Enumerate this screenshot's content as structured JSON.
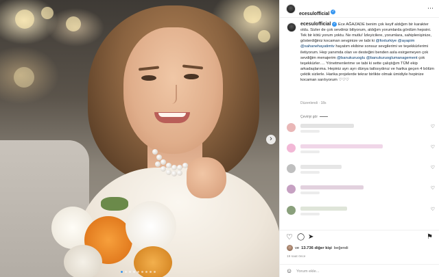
{
  "post": {
    "username": "ecesulofficial",
    "more_icon": "⋯",
    "next_icon": "›",
    "carousel_dots": 9,
    "carousel_active_index": 0,
    "caption": {
      "username": "ecesulofficial",
      "segments": [
        {
          "text": " Ece AĞAZADE benim çok keyif aldığım bir karakter oldu. Sizler de çok sevdiniz biliyorum, aldığım yorumlarda gördüm hepsini. Tek bir kötü yorum yoktu. Ne mutlu! İzleyicilere, yorumlara, sahiplenişinize, gösterdiğiniz kocaman sevginize ve tabi ki ",
          "mention": false
        },
        {
          "text": "@foxturkiye",
          "mention": true
        },
        {
          "text": " ",
          "mention": false
        },
        {
          "text": "@ayapim",
          "mention": true
        },
        {
          "text": " ",
          "mention": false
        },
        {
          "text": "@sahanehayatimtv",
          "mention": true
        },
        {
          "text": " hayatım ekibine sonsuz sevgilerimi ve teşekkürlerimi iletiyorum. Hep yanımda olan ve desteğini benden asla esirgemeyen çok sevdiğim menajerim ",
          "mention": false
        },
        {
          "text": "@banukuruoglu",
          "mention": true
        },
        {
          "text": " ",
          "mention": false
        },
        {
          "text": "@banukuruoglumanagement",
          "mention": true
        },
        {
          "text": " çok teşekkürler…. Yönetmenlerime ve tabi ki sette çalıştığım TÜM ekip arkadaşlarıma. Hepiniz ayrı ayrı dünya tatlısıydınız ve harika geçen 4 bölüm çektik sizlerle. Harika projelerde tekrar birlikte olmak ümidiyle hepinize kocaman sarılıyorum ♡♡♡",
          "mention": false
        }
      ]
    },
    "meta": {
      "edited": "Düzenlendi",
      "separator": "·",
      "age": "18s"
    },
    "translate_label": "Çeviriyi gör",
    "comments": [
      {
        "avatar_color": "#e9b7b7",
        "text_color": "#e3e3e3",
        "width": 78
      },
      {
        "avatar_color": "#f2b8d6",
        "text_color": "#f0d6e8",
        "width": 120
      },
      {
        "avatar_color": "#bfbfbf",
        "text_color": "#e6e6e6",
        "width": 60
      },
      {
        "avatar_color": "#c6a1c2",
        "text_color": "#e2d1de",
        "width": 92
      },
      {
        "avatar_color": "#8aa07c",
        "text_color": "#dfe5d9",
        "width": 68
      }
    ],
    "heart_icon": "♡",
    "actions": {
      "like_icon": "♡",
      "comment_icon": "◯",
      "share_icon": "➤",
      "save_icon": "⚑"
    },
    "likes": {
      "prefix": "ve",
      "count": "13.736 diğer kişi",
      "suffix": "beğendi"
    },
    "time": "19 saat önce",
    "add_comment": {
      "emoji_icon": "☺",
      "placeholder": "Yorum ekle..."
    },
    "colors": {
      "link": "#00376b",
      "verified": "#3897f0",
      "muted": "#8e8e8e"
    }
  }
}
